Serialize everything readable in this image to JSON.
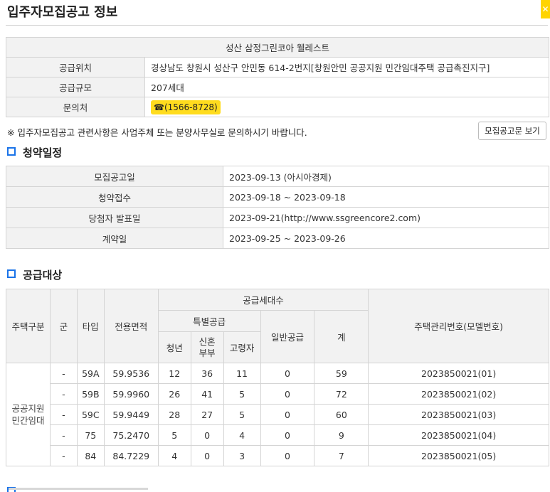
{
  "page": {
    "title": "입주자모집공고 정보"
  },
  "complex": {
    "name": "성산 삼정그린코아 웰레스트",
    "rows": [
      {
        "label": "공급위치",
        "value": "경상남도 창원시 성산구 안민동 614-2번지[창원안민 공공지원 민간임대주택 공급촉진지구]"
      },
      {
        "label": "공급규모",
        "value": "207세대"
      }
    ],
    "contact": {
      "label": "문의처",
      "phone": "☎(1566-8728)"
    }
  },
  "notice": {
    "text": "※ 입주자모집공고 관련사항은 사업주체 또는 분양사무실로 문의하시기 바랍니다.",
    "button": "모집공고문 보기"
  },
  "schedule": {
    "heading": "청약일정",
    "rows": [
      {
        "label": "모집공고일",
        "value": "2023-09-13 (아시아경제)"
      },
      {
        "label": "청약접수",
        "value": "2023-09-18 ~ 2023-09-18"
      },
      {
        "label": "당첨자 발표일",
        "value": "2023-09-21(http://www.ssgreencore2.com)"
      },
      {
        "label": "계약일",
        "value": "2023-09-25 ~ 2023-09-26"
      }
    ]
  },
  "supply": {
    "heading": "공급대상",
    "headers": {
      "housing_type": "주택구분",
      "group": "군",
      "type": "타입",
      "area": "전용면적",
      "units": "공급세대수",
      "special": "특별공급",
      "youth": "청년",
      "newlywed": "신혼\n부부",
      "elderly": "고령자",
      "general": "일반공급",
      "total": "계",
      "model": "주택관리번호(모델번호)"
    },
    "category": "공공지원\n민간임대",
    "rows": [
      {
        "group": "-",
        "type": "59A",
        "area": "59.9536",
        "youth": "12",
        "newlywed": "36",
        "elderly": "11",
        "general": "0",
        "total": "59",
        "model": "2023850021(01)"
      },
      {
        "group": "-",
        "type": "59B",
        "area": "59.9960",
        "youth": "26",
        "newlywed": "41",
        "elderly": "5",
        "general": "0",
        "total": "72",
        "model": "2023850021(02)"
      },
      {
        "group": "-",
        "type": "59C",
        "area": "59.9449",
        "youth": "28",
        "newlywed": "27",
        "elderly": "5",
        "general": "0",
        "total": "60",
        "model": "2023850021(03)"
      },
      {
        "group": "-",
        "type": "75",
        "area": "75.2470",
        "youth": "5",
        "newlywed": "0",
        "elderly": "4",
        "general": "0",
        "total": "9",
        "model": "2023850021(04)"
      },
      {
        "group": "-",
        "type": "84",
        "area": "84.7229",
        "youth": "4",
        "newlywed": "0",
        "elderly": "3",
        "general": "0",
        "total": "7",
        "model": "2023850021(05)"
      }
    ]
  },
  "colors": {
    "accent": "#1a73e8",
    "highlight": "#ffdc1e",
    "header_bg": "#f2f2f2",
    "border": "#d4d4d4"
  },
  "icons": {
    "close": "close-icon",
    "section": "square-bullet-icon",
    "phone": "phone-icon"
  }
}
